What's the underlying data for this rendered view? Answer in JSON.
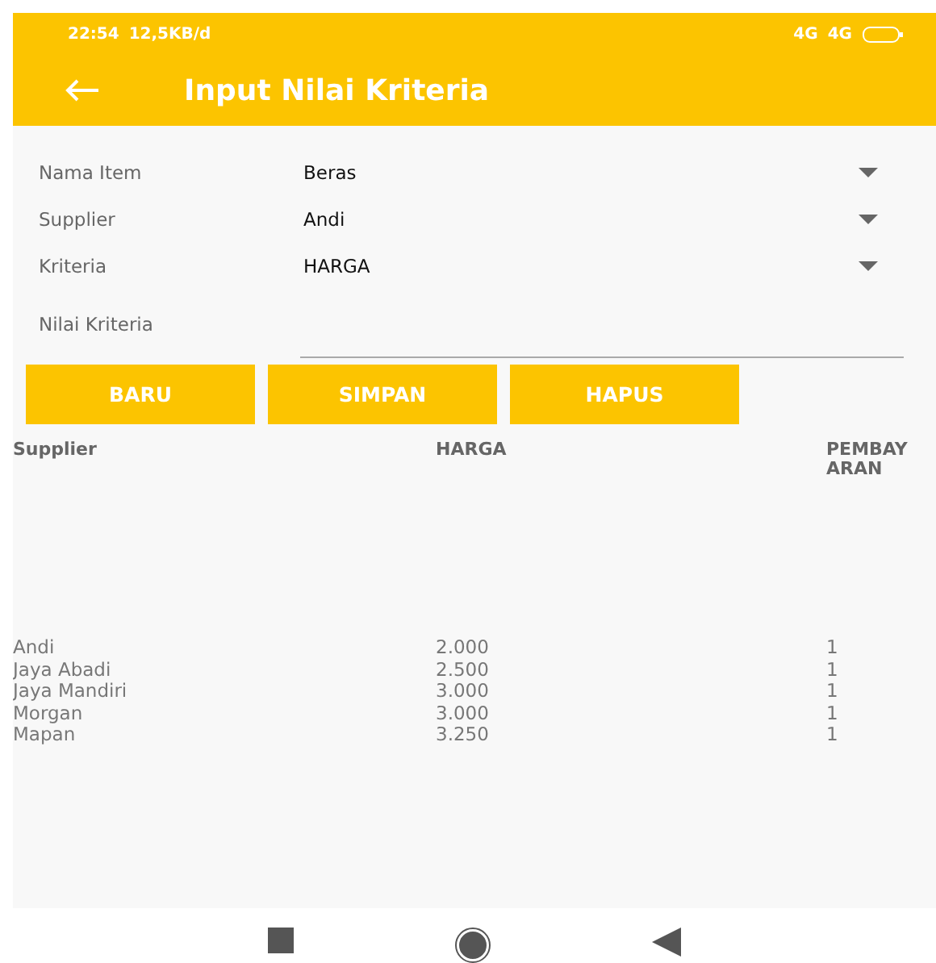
{
  "status_bar": {
    "time": "22:54",
    "speed": "12,5KB/d",
    "network_1": "4G",
    "network_2": "4G"
  },
  "app_bar": {
    "title": "Input Nilai Kriteria"
  },
  "form": [
    {
      "kind": "dropdown",
      "label": "Nama Item",
      "value": "Beras"
    },
    {
      "kind": "dropdown",
      "label": "Supplier",
      "value": "Andi"
    },
    {
      "kind": "dropdown",
      "label": "Kriteria",
      "value": "HARGA"
    },
    {
      "kind": "text",
      "label": "Nilai Kriteria"
    }
  ],
  "buttons": [
    "BARU",
    "SIMPAN",
    "HAPUS"
  ],
  "table": {
    "columns": [
      "Supplier",
      "HARGA",
      "PEMBAY\nARAN"
    ],
    "rows": [
      [
        "Andi",
        "2.000",
        "1"
      ],
      [
        "Jaya Abadi",
        "2.500",
        "1"
      ],
      [
        "Jaya Mandiri",
        "3.000",
        "1"
      ],
      [
        "Morgan",
        "3.000",
        "1"
      ],
      [
        "Mapan",
        "3.250",
        "1"
      ]
    ]
  }
}
